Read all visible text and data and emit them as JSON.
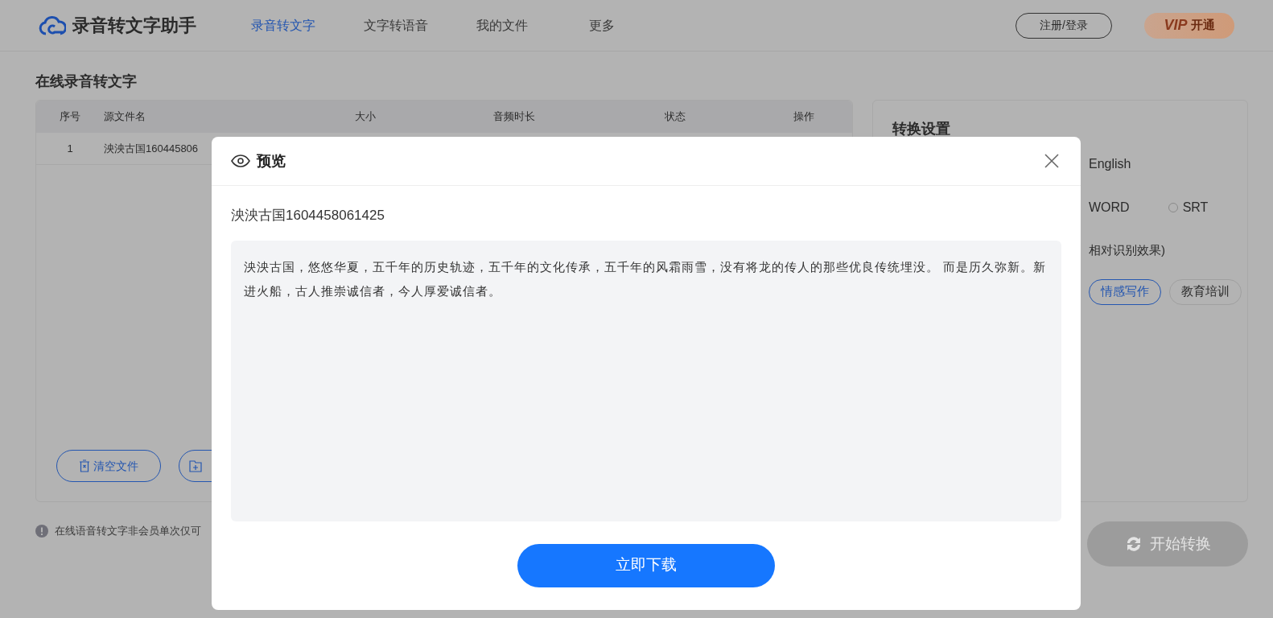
{
  "header": {
    "logo": "录音转文字助手",
    "nav": [
      {
        "label": "录音转文字",
        "selected": true
      },
      {
        "label": "文字转语音",
        "selected": false
      },
      {
        "label": "我的文件",
        "selected": false
      },
      {
        "label": "更多",
        "selected": false
      }
    ],
    "login": "注册/登录",
    "vip": {
      "mark": "VIP",
      "label": "开通"
    }
  },
  "page_title": "在线录音转文字",
  "table": {
    "columns": [
      "序号",
      "源文件名",
      "大小",
      "音频时长",
      "状态",
      "操作"
    ],
    "rows": [
      [
        "1",
        "泱泱古国160445806"
      ]
    ]
  },
  "file_buttons": [
    {
      "kind": "clear",
      "label": "清空文件"
    },
    {
      "kind": "add"
    }
  ],
  "tip": "在线语音转文字非会员单次仅可",
  "settings": {
    "title": "转换设置",
    "language": "English",
    "formats": [
      {
        "kind": "plain",
        "label": "WORD"
      },
      {
        "kind": "radio",
        "label": "SRT",
        "checked": false
      }
    ],
    "note": "相对识别效果)",
    "tags": [
      {
        "label": "情感写作",
        "selected": true
      },
      {
        "label": "教育培训",
        "selected": false
      }
    ]
  },
  "start_button": {
    "label": "开始转换",
    "disabled": true
  },
  "modal": {
    "title": "预览",
    "filename": "泱泱古国1604458061425",
    "content": "泱泱古国，悠悠华夏，五千年的历史轨迹，五千年的文化传承，五千年的风霜雨雪，没有将龙的传人的那些优良传统埋没。 而是历久弥新。新进火船，古人推崇诚信者，今人厚爱诚信者。",
    "download": "立即下载"
  }
}
